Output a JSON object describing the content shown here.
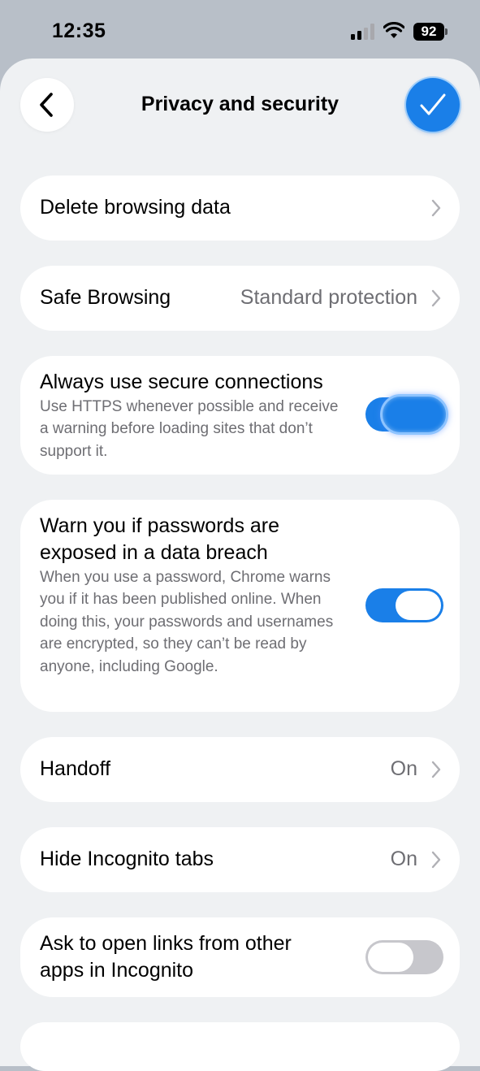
{
  "status_bar": {
    "time": "12:35",
    "battery": "92"
  },
  "header": {
    "title": "Privacy and security",
    "back_icon": "chevron-left-icon",
    "done_icon": "checkmark-icon"
  },
  "colors": {
    "accent": "#1a7fe8",
    "background": "#eff1f3",
    "card": "#ffffff",
    "secondary_text": "#6e6e73"
  },
  "settings": {
    "delete_browsing_data": {
      "label": "Delete browsing data"
    },
    "safe_browsing": {
      "label": "Safe Browsing",
      "value": "Standard protection"
    },
    "secure_connections": {
      "title": "Always use secure connections",
      "description": "Use HTTPS whenever possible and receive a warning before loading sites that don’t support it.",
      "enabled": true
    },
    "password_breach": {
      "title": "Warn you if passwords are exposed in a data breach",
      "description": "When you use a password, Chrome warns you if it has been published online. When doing this, your passwords and usernames are encrypted, so they can’t be read by anyone, including Google.",
      "enabled": true
    },
    "handoff": {
      "label": "Handoff",
      "value": "On"
    },
    "hide_incognito_tabs": {
      "label": "Hide Incognito tabs",
      "value": "On"
    },
    "ask_open_links_incognito": {
      "title": "Ask to open links from other apps in Incognito",
      "enabled": false
    }
  }
}
